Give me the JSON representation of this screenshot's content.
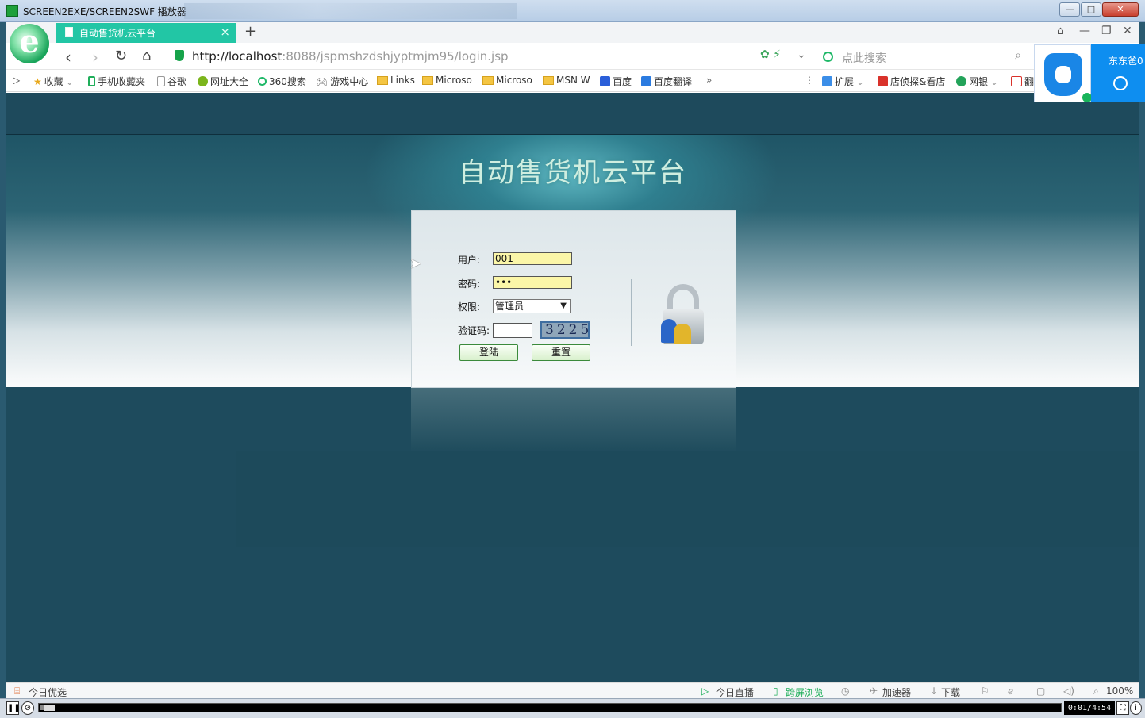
{
  "window": {
    "title": "SCREEN2EXE/SCREEN2SWF 播放器",
    "controls": [
      "—",
      "□",
      "✕"
    ]
  },
  "browser": {
    "tab_title": "自动售货机云平台",
    "tab_close": "×",
    "new_tab": "+",
    "url_host": "http://localhost",
    "url_rest": ":8088/jspmshzdshjyptmjm95/login.jsp",
    "search_placeholder": "点此搜索",
    "bookmarks": [
      {
        "label": "收藏",
        "icon": "star-icon"
      },
      {
        "label": "手机收藏夹",
        "icon": "phone-icon"
      },
      {
        "label": "谷歌",
        "icon": "page-icon"
      },
      {
        "label": "网址大全",
        "icon": "globe-icon"
      },
      {
        "label": "360搜索",
        "icon": "search-360-icon"
      },
      {
        "label": "游戏中心",
        "icon": "gamepad-icon"
      },
      {
        "label": "Links",
        "icon": "folder-icon"
      },
      {
        "label": "Microso",
        "icon": "folder-icon"
      },
      {
        "label": "Microso",
        "icon": "folder-icon"
      },
      {
        "label": "MSN W",
        "icon": "folder-icon"
      },
      {
        "label": "百度",
        "icon": "baidu-icon"
      },
      {
        "label": "百度翻译",
        "icon": "translate-icon"
      }
    ],
    "more_bookmarks": "»",
    "right_bookmarks": [
      {
        "label": "扩展",
        "icon": "extension-icon"
      },
      {
        "label": "店侦探&看店",
        "icon": "shop-icon"
      },
      {
        "label": "网银",
        "icon": "bank-icon"
      },
      {
        "label": "翻",
        "icon": "adblock-icon"
      }
    ],
    "notification_name": "东东爸0"
  },
  "page": {
    "heading": "自动售货机云平台",
    "form": {
      "username_label": "用户:",
      "username_value": "001",
      "password_label": "密码:",
      "password_value": "•••",
      "role_label": "权限:",
      "role_value": "管理员",
      "captcha_label": "验证码:",
      "captcha_value": "",
      "captcha_text": "3225",
      "login_button": "登陆",
      "reset_button": "重置"
    }
  },
  "statusbar": {
    "left": "今日优选",
    "items": [
      "今日直播",
      "跨屏浏览",
      "加速器",
      "下载"
    ],
    "zoom": "100%"
  },
  "player": {
    "time": "0:01/4:54",
    "progress": 0.01
  },
  "colors": {
    "tab_active": "#22c6a5",
    "heading": "#cfeee0",
    "input_highlight": "#fbf6a8",
    "page_bg": "#1e4b5d"
  }
}
